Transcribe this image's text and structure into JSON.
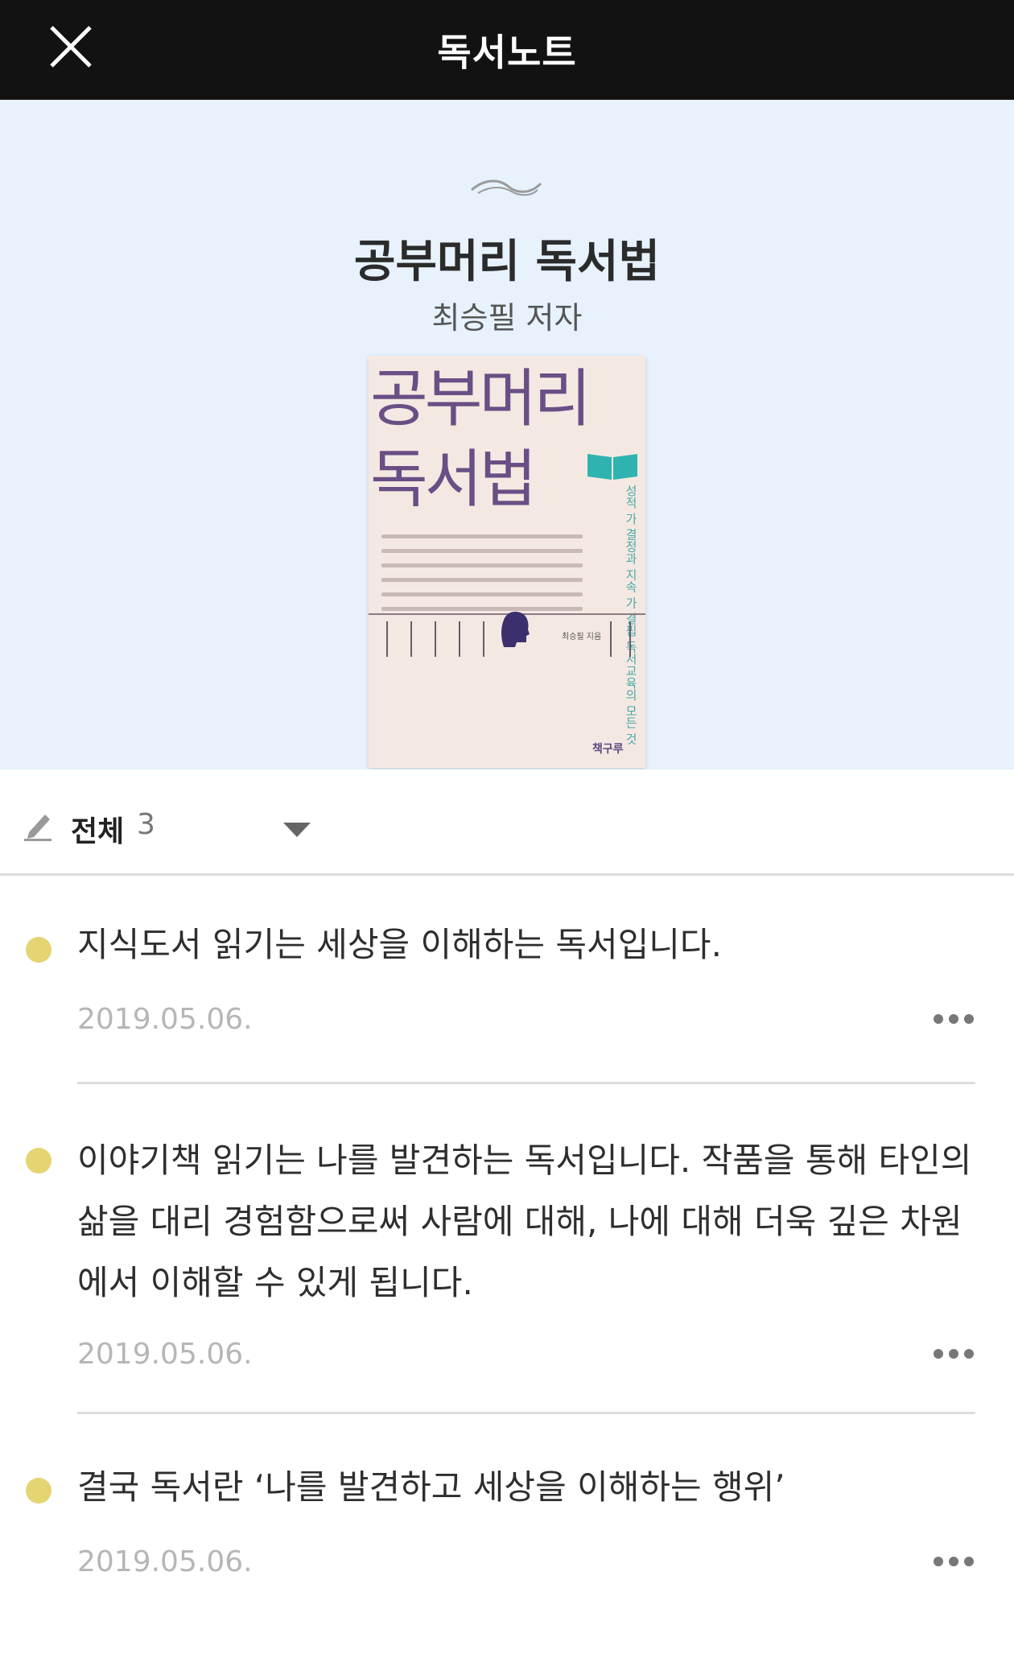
{
  "header": {
    "title": "독서노트",
    "close_icon": "close-icon"
  },
  "book": {
    "title": "공부머리 독서법",
    "author": "최승필 저자",
    "cover": {
      "title_line1": "공부머리",
      "title_line2": "독서법",
      "subtitle": "성적 가 결정과 지속 가 결핍 독서교육의 모든 것",
      "publisher": "책구루",
      "author_small": "최승필 지음"
    }
  },
  "filter": {
    "label": "전체",
    "count": "3"
  },
  "notes": [
    {
      "text": "지식도서 읽기는 세상을 이해하는 독서입니다.",
      "date": "2019.05.06."
    },
    {
      "text": "이야기책 읽기는 나를 발견하는 독서입니다. 작품을 통해 타인의 삶을 대리 경험함으로써 사람에 대해, 나에 대해 더욱 깊은 차원에서 이해할 수 있게 됩니다.",
      "date": "2019.05.06."
    },
    {
      "text": "결국 독서란 ‘나를 발견하고 세상을 이해하는 행위’",
      "date": "2019.05.06."
    }
  ],
  "colors": {
    "topbar": "#121212",
    "hero_bg": "#e7f2fd",
    "note_dot": "#e4d572"
  }
}
